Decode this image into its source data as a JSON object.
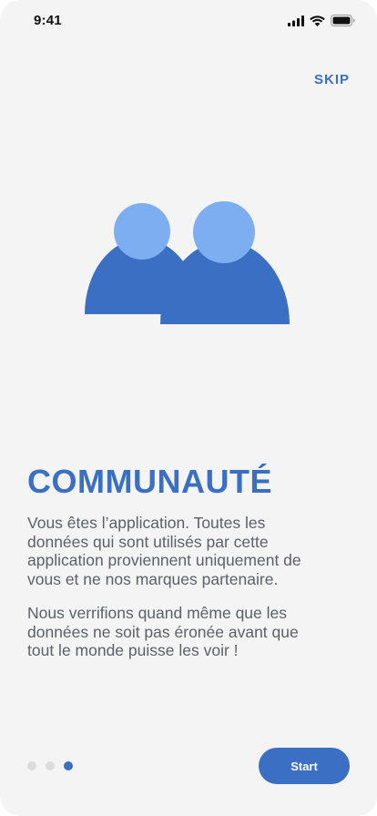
{
  "status_bar": {
    "time": "9:41",
    "icons": [
      "signal-icon",
      "wifi-icon",
      "battery-icon"
    ]
  },
  "header": {
    "skip_label": "SKIP"
  },
  "illustration": {
    "icon": "community-people-icon",
    "colors": {
      "body": "#3a6fc4",
      "head": "#7eaef2"
    }
  },
  "content": {
    "title": "COMMUNAUTÉ",
    "paragraph1_lines": [
      "Vous êtes l’application. Toutes les",
      "données qui sont utilisés par cette",
      "application proviennent uniquement de",
      "vous et ne nos marques partenaire."
    ],
    "paragraph2_lines": [
      "Nous verrifions quand même que les",
      "données ne soit pas éronée avant que",
      "tout le monde puisse les voir !"
    ]
  },
  "pagination": {
    "total": 3,
    "active_index": 2
  },
  "footer": {
    "start_label": "Start"
  },
  "colors": {
    "accent": "#3a6fc4",
    "accent_light": "#7eaef2",
    "background": "#f4f4f4",
    "text": "#5d6068",
    "dot_inactive": "#dcdcdc"
  }
}
